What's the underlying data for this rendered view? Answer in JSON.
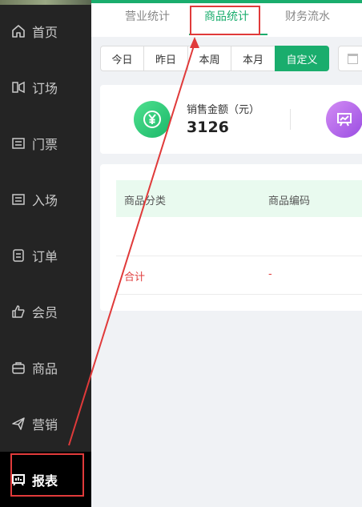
{
  "sidebar": {
    "items": [
      {
        "label": "首页",
        "icon": "home-icon"
      },
      {
        "label": "订场",
        "icon": "venue-booking-icon"
      },
      {
        "label": "门票",
        "icon": "ticket-icon"
      },
      {
        "label": "入场",
        "icon": "entry-icon"
      },
      {
        "label": "订单",
        "icon": "order-icon"
      },
      {
        "label": "会员",
        "icon": "member-icon"
      },
      {
        "label": "商品",
        "icon": "goods-icon"
      },
      {
        "label": "营销",
        "icon": "send-icon"
      },
      {
        "label": "报表",
        "icon": "report-icon",
        "active": true
      }
    ]
  },
  "tabs": [
    {
      "label": "营业统计"
    },
    {
      "label": "商品统计",
      "active": true
    },
    {
      "label": "财务流水"
    }
  ],
  "filter": {
    "buttons": [
      "今日",
      "昨日",
      "本周",
      "本月",
      "自定义"
    ],
    "active": "自定义"
  },
  "stats": {
    "sales_label": "销售金额（元）",
    "sales_value": "3126"
  },
  "table": {
    "headers": [
      "商品分类",
      "商品编码"
    ],
    "total_row": [
      "合计",
      "-"
    ]
  },
  "colors": {
    "accent": "#1aad6d",
    "sidebar_bg": "#242424",
    "annotation": "#e03a3a"
  }
}
